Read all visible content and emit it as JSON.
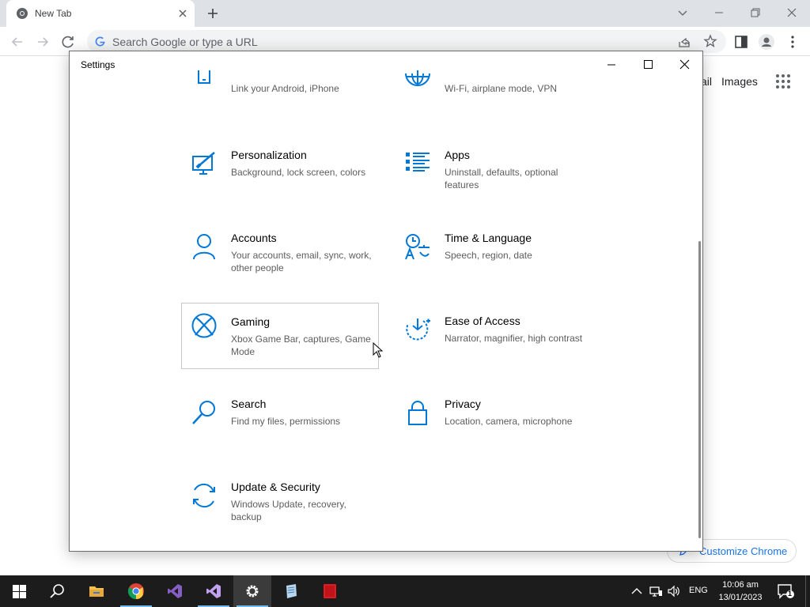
{
  "chrome": {
    "tab_title": "New Tab",
    "omnibox_placeholder": "Search Google or type a URL",
    "ntp_links": [
      "ail",
      "Images"
    ],
    "customize_label": "Customize Chrome"
  },
  "settings": {
    "window_title": "Settings",
    "tiles": [
      {
        "title": "",
        "desc": "Link your Android, iPhone",
        "icon": "phone-icon"
      },
      {
        "title": "",
        "desc": "Wi-Fi, airplane mode, VPN",
        "icon": "globe-icon"
      },
      {
        "title": "Personalization",
        "desc": "Background, lock screen, colors",
        "icon": "personalization-icon"
      },
      {
        "title": "Apps",
        "desc": "Uninstall, defaults, optional features",
        "icon": "apps-list-icon"
      },
      {
        "title": "Accounts",
        "desc": "Your accounts, email, sync, work, other people",
        "icon": "person-icon"
      },
      {
        "title": "Time & Language",
        "desc": "Speech, region, date",
        "icon": "time-language-icon"
      },
      {
        "title": "Gaming",
        "desc": "Xbox Game Bar, captures, Game Mode",
        "icon": "xbox-icon"
      },
      {
        "title": "Ease of Access",
        "desc": "Narrator, magnifier, high contrast",
        "icon": "ease-of-access-icon"
      },
      {
        "title": "Search",
        "desc": "Find my files, permissions",
        "icon": "search-icon"
      },
      {
        "title": "Privacy",
        "desc": "Location, camera, microphone",
        "icon": "lock-icon"
      },
      {
        "title": "Update & Security",
        "desc": "Windows Update, recovery, backup",
        "icon": "sync-icon"
      }
    ]
  },
  "taskbar": {
    "language": "ENG",
    "time": "10:06 am",
    "date": "13/01/2023",
    "notification_count": "1"
  },
  "colors": {
    "accent": "#0078d7",
    "taskbar": "#1c1c1c"
  }
}
